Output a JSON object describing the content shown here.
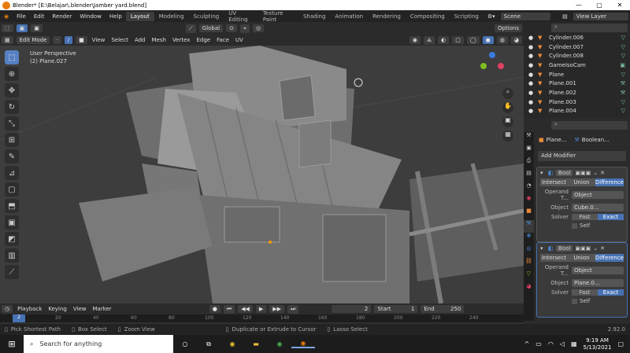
{
  "window": {
    "title": "Blender* [E:\\Belajar\\.blender\\Jamber yard.blend]",
    "controls": [
      "—",
      "▢",
      "✕"
    ]
  },
  "menu": [
    "File",
    "Edit",
    "Render",
    "Window",
    "Help"
  ],
  "workspaces": [
    "Layout",
    "Modeling",
    "Sculpting",
    "UV Editing",
    "Texture Paint",
    "Shading",
    "Animation",
    "Rendering",
    "Compositing",
    "Scripting"
  ],
  "scene": "Scene",
  "view_layer": "View Layer",
  "transform_orientation": "Global",
  "options_label": "Options",
  "mode": "Edit Mode",
  "view_menu": [
    "View",
    "Select",
    "Add",
    "Mesh",
    "Vertex",
    "Edge",
    "Face",
    "UV"
  ],
  "viewport": {
    "perspective": "User Perspective",
    "object": "(2) Plane.027"
  },
  "timeline": {
    "playback": "Playback",
    "keying": "Keying",
    "view": "View",
    "marker": "Marker",
    "frame": "2",
    "start_label": "Start",
    "start": "1",
    "end_label": "End",
    "end": "250"
  },
  "ruler_ticks": [
    "0",
    "20",
    "40",
    "60",
    "80",
    "100",
    "120",
    "140",
    "160",
    "180",
    "200",
    "220",
    "240"
  ],
  "status": {
    "a": "Pick Shortest Path",
    "b": "Box Select",
    "c": "Zoom View",
    "d": "Duplicate or Extrude to Cursor",
    "e": "Lasso Select",
    "version": "2.92.0"
  },
  "outliner": [
    "Cylinder.006",
    "Cylinder.007",
    "Cylinder.008",
    "GameIsoCam",
    "Plane",
    "Plane.001",
    "Plane.002",
    "Plane.003",
    "Plane.004"
  ],
  "props": {
    "object": "Plane...",
    "modifier": "Boolean...",
    "add_modifier": "Add Modifier"
  },
  "modifiers": [
    {
      "name": "Bool",
      "ops": [
        "Intersect",
        "Union",
        "Difference"
      ],
      "operand_label": "Operand T...",
      "operand": "Object",
      "object_label": "Object",
      "object": "Cube.0...",
      "solver_label": "Solver",
      "solvers": [
        "Fast",
        "Exact"
      ],
      "self": "Self"
    },
    {
      "name": "Bool",
      "ops": [
        "Intersect",
        "Union",
        "Difference"
      ],
      "operand_label": "Operand T...",
      "operand": "Object",
      "object_label": "Object",
      "object": "Plane.0...",
      "solver_label": "Solver",
      "solvers": [
        "Fast",
        "Exact"
      ],
      "self": "Self"
    }
  ],
  "taskbar": {
    "search": "Search for anything",
    "time": "9:19 AM",
    "date": "5/13/2021"
  }
}
